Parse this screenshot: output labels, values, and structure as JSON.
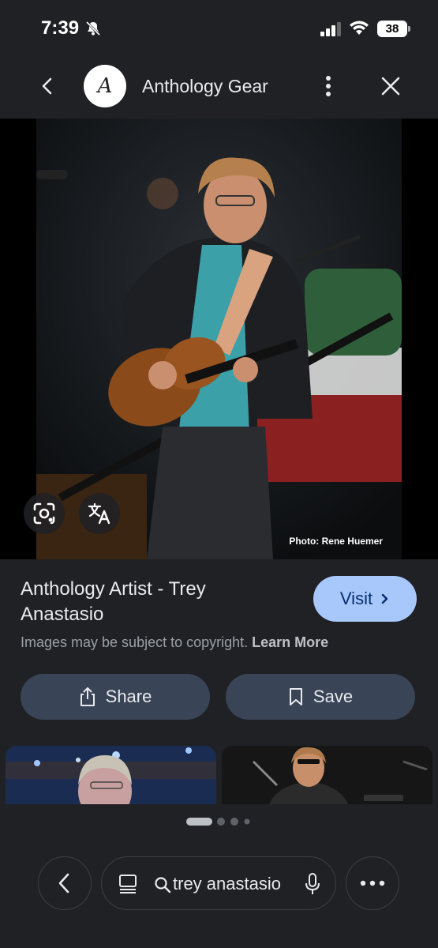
{
  "status_bar": {
    "time": "7:39",
    "battery": "38",
    "icons": [
      "bell-off-icon",
      "cellular-signal-icon",
      "wifi-icon",
      "battery-icon"
    ]
  },
  "header": {
    "title": "Anthology Gear",
    "logo_letter": "A",
    "icons": [
      "back-arrow-icon",
      "more-vert-icon",
      "close-icon"
    ]
  },
  "image": {
    "credit": "Photo: Rene Huemer",
    "overlay_icons": [
      "lens-icon",
      "translate-icon"
    ]
  },
  "result": {
    "title": "Anthology Artist - Trey Anastasio",
    "visit_label": "Visit",
    "copyright_text": "Images may be subject to copyright.",
    "learn_more": "Learn More"
  },
  "actions": {
    "share_label": "Share",
    "save_label": "Save"
  },
  "carousel": {
    "dot_count": 4,
    "active_index": 0
  },
  "bottom_bar": {
    "search_query": "trey anastasio",
    "icons": [
      "back-chevron-icon",
      "tabs-icon",
      "search-icon",
      "mic-icon",
      "more-horiz-icon"
    ]
  },
  "colors": {
    "background": "#202124",
    "visit_button": "#a8c7fa",
    "action_button": "#394457"
  }
}
